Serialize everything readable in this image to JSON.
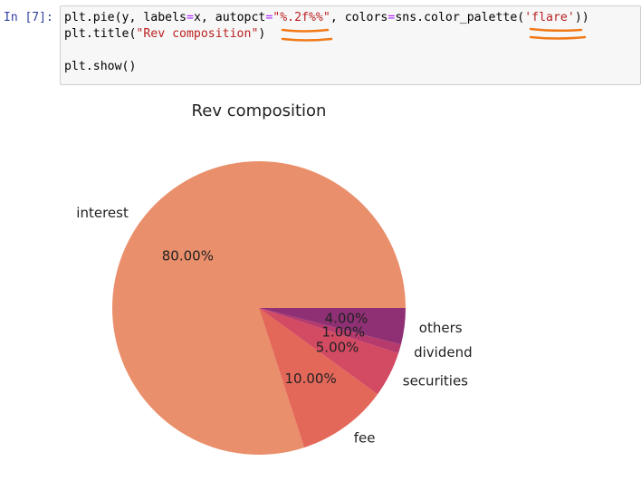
{
  "cell": {
    "prompt": "In [7]:",
    "code_lines": [
      [
        {
          "t": "plt.pie(y, labels"
        },
        {
          "t": "=",
          "c": "eq"
        },
        {
          "t": "x, autopct"
        },
        {
          "t": "=",
          "c": "eq"
        },
        {
          "t": "\"%.2f%%\"",
          "c": "str"
        },
        {
          "t": ", colors"
        },
        {
          "t": "=",
          "c": "eq"
        },
        {
          "t": "sns.color_palette("
        },
        {
          "t": "'flare'",
          "c": "str"
        },
        {
          "t": "))"
        }
      ],
      [
        {
          "t": "plt.title("
        },
        {
          "t": "\"Rev composition\"",
          "c": "str"
        },
        {
          "t": ")"
        }
      ],
      [
        {
          "t": ""
        }
      ],
      [
        {
          "t": "plt.show()"
        }
      ]
    ]
  },
  "annotation_color": "#f07a1a",
  "chart_data": {
    "type": "pie",
    "title": "Rev composition",
    "labels": [
      "interest",
      "fee",
      "securities",
      "dividend",
      "others"
    ],
    "values": [
      80,
      10,
      5,
      1,
      4
    ],
    "percent_labels": [
      "80.00%",
      "10.00%",
      "5.00%",
      "1.00%",
      "4.00%"
    ],
    "colors": [
      "#ea8f6b",
      "#e4685a",
      "#d34a63",
      "#b63a6c",
      "#8f2f74"
    ]
  }
}
